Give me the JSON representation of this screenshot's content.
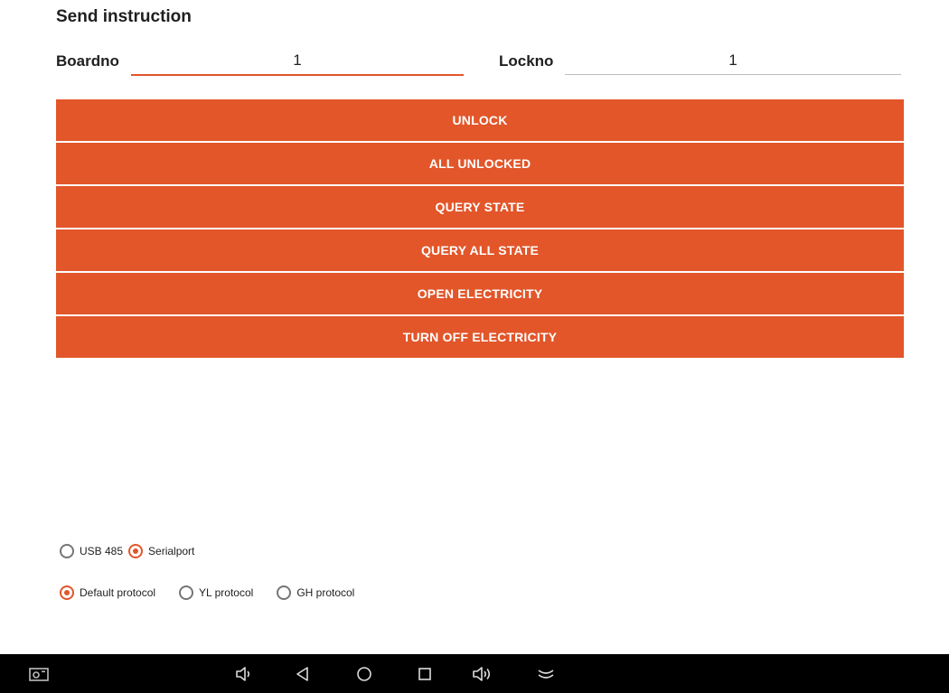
{
  "header": {
    "title": "Send instruction"
  },
  "fields": {
    "boardno": {
      "label": "Boardno",
      "value": "1"
    },
    "lockno": {
      "label": "Lockno",
      "value": "1"
    }
  },
  "buttons": {
    "unlock": "UNLOCK",
    "all_unlocked": "ALL UNLOCKED",
    "query_state": "QUERY STATE",
    "query_all_state": "QUERY ALL STATE",
    "open_electricity": "OPEN ELECTRICITY",
    "turn_off_electricity": "TURN OFF ELECTRICITY"
  },
  "port": {
    "options": [
      {
        "label": "USB 485",
        "checked": false
      },
      {
        "label": "Serialport",
        "checked": true
      }
    ]
  },
  "protocol": {
    "options": [
      {
        "label": "Default protocol",
        "checked": true
      },
      {
        "label": "YL protocol",
        "checked": false
      },
      {
        "label": "GH protocol",
        "checked": false
      }
    ]
  },
  "navbar": {
    "icons": [
      "screenshot-icon",
      "volume-down-icon",
      "back-icon",
      "home-icon",
      "recents-icon",
      "volume-up-icon",
      "hide-navbar-icon"
    ]
  },
  "colors": {
    "accent": "#e2562a",
    "navbar": "#000000"
  }
}
